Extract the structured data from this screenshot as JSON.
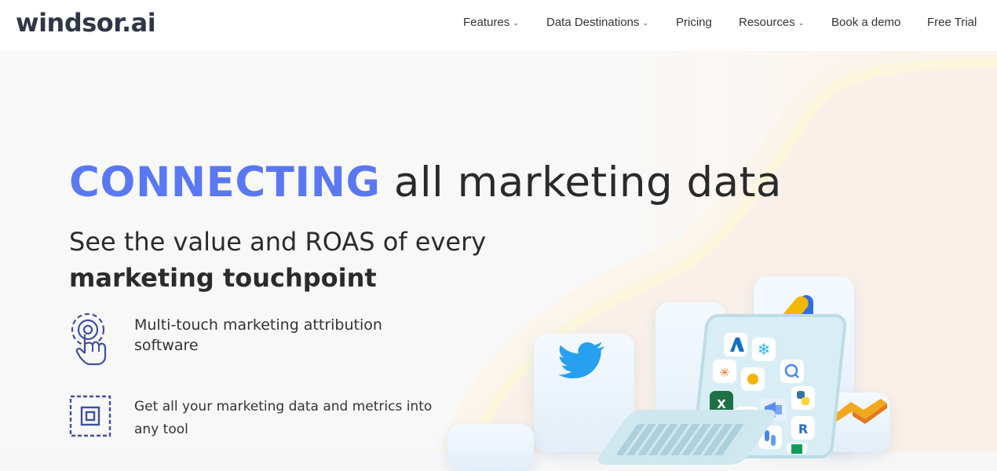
{
  "header": {
    "logo": "windsor.ai",
    "nav": [
      {
        "label": "Features",
        "dropdown": true
      },
      {
        "label": "Data Destinations",
        "dropdown": true
      },
      {
        "label": "Pricing",
        "dropdown": false
      },
      {
        "label": "Resources",
        "dropdown": true
      },
      {
        "label": "Book a demo",
        "dropdown": false
      },
      {
        "label": "Free Trial",
        "dropdown": false
      }
    ]
  },
  "hero": {
    "headline_accent": "CONNECTING",
    "headline_rest": " all marketing data",
    "sub_line1": "See the value and ROAS of every",
    "sub_line2": "marketing touchpoint",
    "features": [
      {
        "icon": "touch-icon",
        "text_line1": "Multi-touch marketing attribution",
        "text_line2": "software"
      },
      {
        "icon": "frame-icon",
        "text_line1": "Get all your marketing data and metrics into",
        "text_line2": "any tool"
      }
    ]
  },
  "colors": {
    "accent": "#5a78f4",
    "icon_blue": "#3f4f9e"
  },
  "illustration": {
    "icons": [
      "twitter-icon",
      "google-ads-icon",
      "azure-icon",
      "snowflake-icon",
      "tableau-icon",
      "bigquery-icon",
      "python-icon",
      "excel-icon",
      "access-icon",
      "megaphone-icon",
      "looker-studio-icon",
      "r-icon",
      "sheets-icon",
      "power-bi-icon"
    ]
  }
}
